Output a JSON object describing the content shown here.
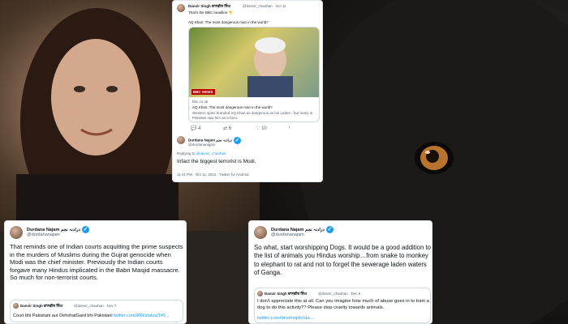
{
  "tweet_top": {
    "author": {
      "name": "Danvir Singh ਦਾਨਵੀਰ ਸਿੰਘ",
      "handle": "@danvir_chauhan",
      "time": "Oct 11"
    },
    "text": "That's the BBC headline 👇",
    "headline": "AQ Khan: The most dangerous man in the world?",
    "image_badge": "BBC NEWS",
    "link_card": {
      "domain": "bbc.co.uk",
      "title": "AQ Khan: The most dangerous man in the world?",
      "desc": "Western spies branded AQ Khan as dangerous as bin Laden - but many in Pakistan saw him as a hero."
    },
    "counts": {
      "replies": "4",
      "retweets": "6",
      "likes": "10"
    },
    "reply": {
      "name": "Durdana Najam درادنہ نجم",
      "handle": "@durdananajam",
      "replying_prefix": "Replying to",
      "replying_to": "@danvir_chauhan",
      "text": "Infact the biggest terrorist is Modi.",
      "meta": "11:41 PM · Oct 11, 2021 · Twitter for Android"
    }
  },
  "tweet_bottom_left": {
    "name": "Durdana Najam درادنہ نجم",
    "handle": "@durdananajam",
    "text": "That reminds one of Indian courts acquitting the prime suspects in the murders of Muslims during the Gujrat genocide when Modi was the chief minister. Previously the Indian courts forgave many Hindus implicated in the Babri Masjid massacre. So much for non-terrorist courts.",
    "quote": {
      "name": "Danvir Singh ਦਾਨਵੀਰ ਸਿੰਘ",
      "handle": "@danvir_chauhan",
      "time": "· Nov 7",
      "text": "Court bhi Pakistani aur DehshatGard bhi Pakistani",
      "link": "twitter.com/ANI/status/145..."
    }
  },
  "tweet_bottom_right": {
    "name": "Durdana Najam درادنہ نجم",
    "handle": "@durdananajam",
    "text": "So what, start worshipping Dogs. It would be a good addition to the list of animals you Hindus worship…from snake to monkey to elephant to rat and not to forget the sewerage laden waters of Ganga.",
    "quote": {
      "name": "Danvir Singh ਦਾਨਵੀਰ ਸਿੰਘ",
      "handle": "@danvir_chauhan",
      "time": "· Dec 6",
      "text": "I don't appreciate this at all. Can you imagine how much of abuse goes in to train a dog to do this activity?? Please stop cruelty towards animals.",
      "link": "twitter.com/desimojito/sta..."
    }
  },
  "colors": {
    "twitter_blue": "#1d9bf0",
    "text_dark": "#0f1419",
    "text_gray": "#536471"
  }
}
